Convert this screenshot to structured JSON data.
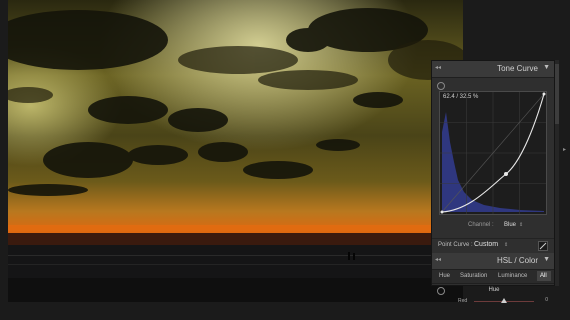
{
  "tone_curve": {
    "title": "Tone Curve",
    "readout": "62.4 / 32.5 %",
    "channel_label": "Channel :",
    "channel_value": "Blue",
    "point_curve_label": "Point Curve :",
    "point_curve_value": "Custom"
  },
  "hsl": {
    "title": "HSL / Color",
    "tabs": [
      "Hue",
      "Saturation",
      "Luminance",
      "All"
    ],
    "active_tab": "All",
    "section": "Hue",
    "slider_label": "Red",
    "slider_value": "0"
  },
  "colors": {
    "panel_bg": "#2f2f2f",
    "header_bg": "#3a3a3a",
    "curve_line": "#e8e8e8",
    "histogram_blue": "#3540a0"
  }
}
